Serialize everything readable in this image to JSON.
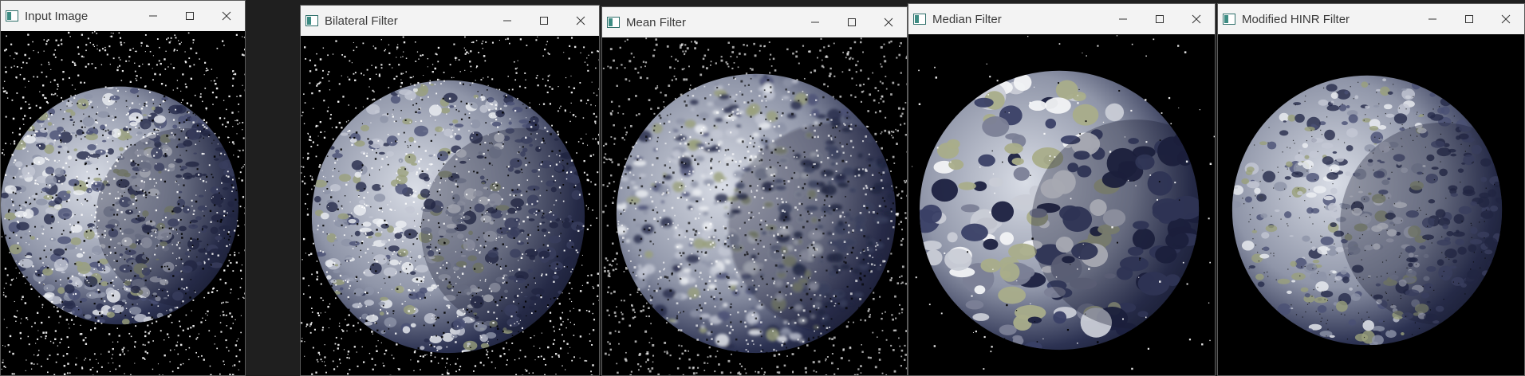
{
  "windows": [
    {
      "id": "input",
      "title": "Input Image",
      "noise": "heavy",
      "style": "raw"
    },
    {
      "id": "bilateral",
      "title": "Bilateral Filter",
      "noise": "heavy",
      "style": "raw"
    },
    {
      "id": "mean",
      "title": "Mean Filter",
      "noise": "heavy",
      "style": "blurred"
    },
    {
      "id": "median",
      "title": "Median Filter",
      "noise": "sparse",
      "style": "posterized"
    },
    {
      "id": "hinr",
      "title": "Modified HINR Filter",
      "noise": "none",
      "style": "clean"
    }
  ],
  "icons": {
    "app": "opencv-window-icon",
    "minimize": "minimize-icon",
    "maximize": "maximize-icon",
    "close": "close-icon"
  },
  "colors": {
    "titlebar": "#f3f3f3",
    "title_text": "#3a3a3a",
    "view_background": "#000000",
    "earth_light": "#d9dde6",
    "earth_dark": "#2c3252",
    "earth_shadow": "#1a1e35"
  }
}
